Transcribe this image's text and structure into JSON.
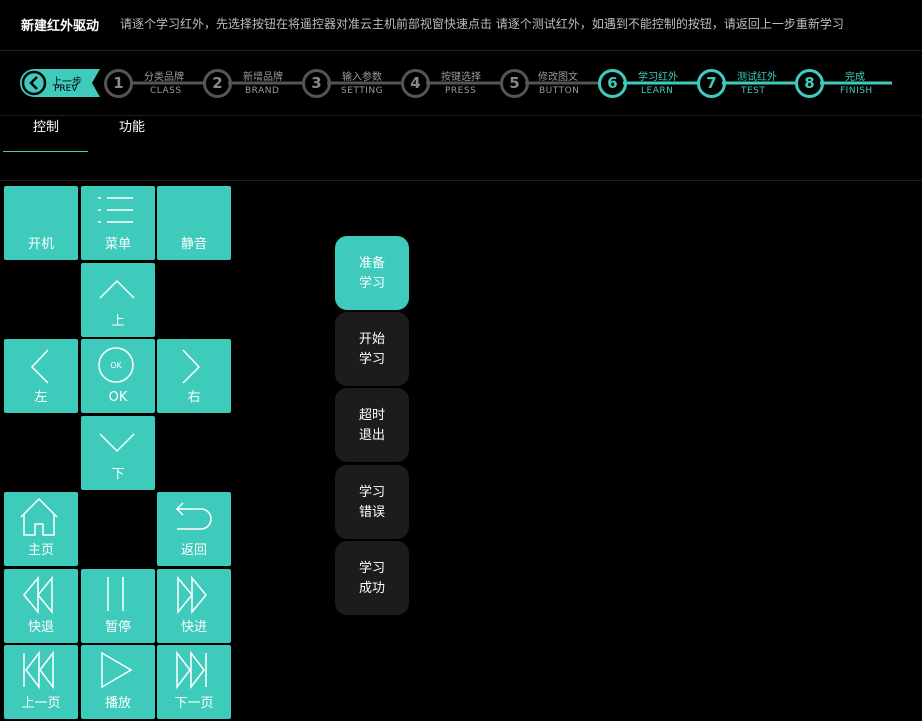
{
  "header": {
    "title": "新建红外驱动",
    "description": "请逐个学习红外，先选择按钮在将遥控器对准云主机前部视窗快速点击   请逐个测试红外，如遇到不能控制的按钮，请返回上一步重新学习"
  },
  "steps": {
    "prev": {
      "cn": "上一步",
      "en": "PREV"
    },
    "items": [
      {
        "num": "1",
        "cn": "分类品牌",
        "en": "CLASS",
        "active": false
      },
      {
        "num": "2",
        "cn": "新增品牌",
        "en": "BRAND",
        "active": false
      },
      {
        "num": "3",
        "cn": "输入参数",
        "en": "SETTING",
        "active": false
      },
      {
        "num": "4",
        "cn": "按键选择",
        "en": "PRESS",
        "active": false
      },
      {
        "num": "5",
        "cn": "修改图文",
        "en": "BUTTON",
        "active": false
      },
      {
        "num": "6",
        "cn": "学习红外",
        "en": "LEARN",
        "active": true
      },
      {
        "num": "7",
        "cn": "测试红外",
        "en": "TEST",
        "active": true
      },
      {
        "num": "8",
        "cn": "完成",
        "en": "FINISH",
        "active": true
      }
    ]
  },
  "tabs": {
    "control": "控制",
    "function": "功能"
  },
  "keys": {
    "power": "开机",
    "menu": "菜单",
    "mute": "静音",
    "up": "上",
    "left": "左",
    "ok": "OK",
    "ok_icon": "OK",
    "right": "右",
    "down": "下",
    "home": "主页",
    "back": "返回",
    "rewind": "快退",
    "pause": "暂停",
    "forward": "快进",
    "prev_page": "上一页",
    "play": "播放",
    "next_page": "下一页"
  },
  "status": [
    {
      "line1": "准备",
      "line2": "学习",
      "active": true
    },
    {
      "line1": "开始",
      "line2": "学习",
      "active": false
    },
    {
      "line1": "超时",
      "line2": "退出",
      "active": false
    },
    {
      "line1": "学习",
      "line2": "错误",
      "active": false
    },
    {
      "line1": "学习",
      "line2": "成功",
      "active": false
    }
  ],
  "colors": {
    "accent": "#3ecbbc",
    "inactive": "#555555",
    "status_bg": "#1c1c1c"
  }
}
